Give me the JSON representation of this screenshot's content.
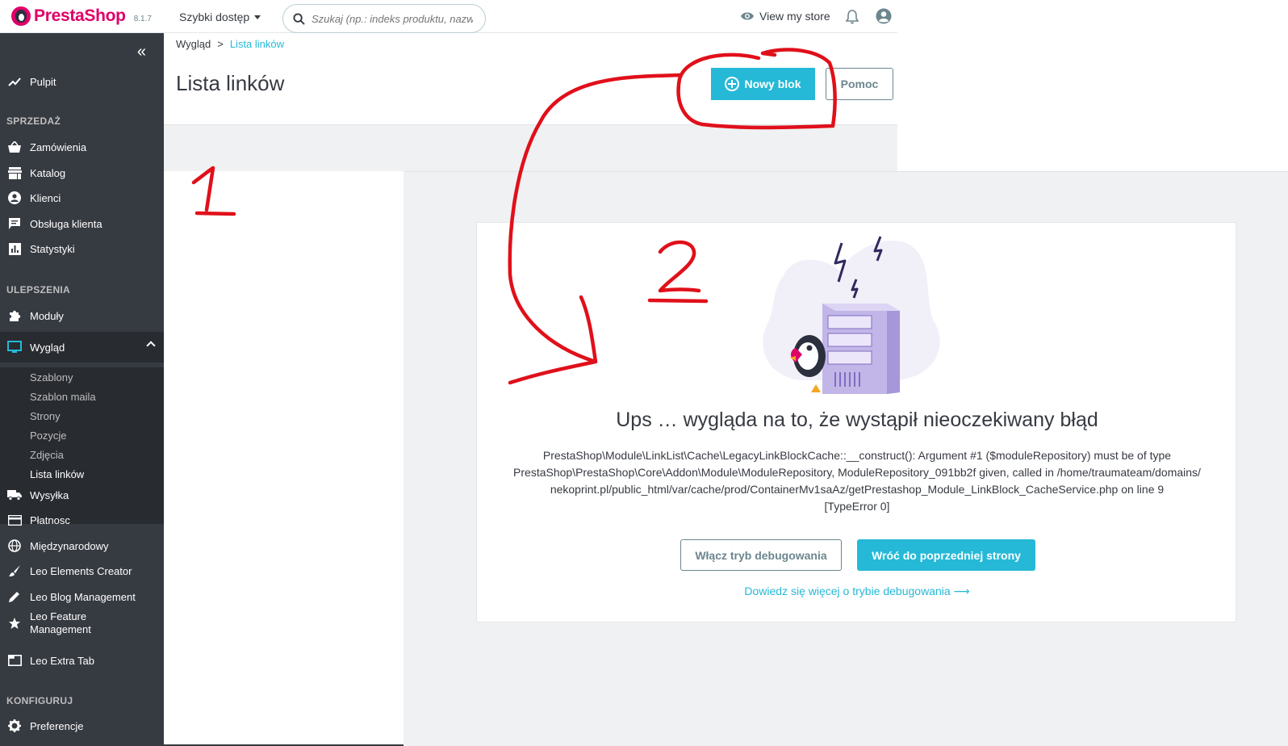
{
  "header": {
    "logo_text": "PrestaShop",
    "version": "8.1.7",
    "quick_access": "Szybki dostęp",
    "search_placeholder": "Szukaj (np.: indeks produktu, nazwa k",
    "view_store": "View my store"
  },
  "sidebar": {
    "dashboard": "Pulpit",
    "section_sales": "SPRZEDAŻ",
    "orders": "Zamówienia",
    "catalog": "Katalog",
    "customers": "Klienci",
    "customer_service": "Obsługa klienta",
    "stats": "Statystyki",
    "section_improve": "ULEPSZENIA",
    "modules": "Moduły",
    "design": "Wygląd",
    "design_sub": [
      "Szablony",
      "Szablon maila",
      "Strony",
      "Pozycje",
      "Zdjęcia",
      "Lista linków"
    ],
    "shipping": "Wysyłka",
    "payment": "Płatnosc",
    "international": "Międzynarodowy",
    "leo_elements": "Leo Elements Creator",
    "leo_blog": "Leo Blog Management",
    "leo_feature_1": "Leo Feature",
    "leo_feature_2": "Management",
    "leo_extra": "Leo Extra Tab",
    "section_config": "KONFIGURUJ",
    "preferences": "Preferencje"
  },
  "page": {
    "breadcrumb_parent": "Wygląd",
    "breadcrumb_sep": ">",
    "breadcrumb_current": "Lista linków",
    "title": "Lista linków",
    "new_block_button": "Nowy blok",
    "help_button": "Pomoc"
  },
  "error": {
    "title": "Ups … wygląda na to, że wystąpił nieoczekiwany błąd",
    "line1": "PrestaShop\\Module\\LinkList\\Cache\\LegacyLinkBlockCache::__construct(): Argument #1 ($moduleRepository) must be of type",
    "line2": "PrestaShop\\PrestaShop\\Core\\Addon\\Module\\ModuleRepository, ModuleRepository_091bb2f given, called in /home/traumateam/domains/",
    "line3": "nekoprint.pl/public_html/var/cache/prod/ContainerMv1saAz/getPrestashop_Module_LinkBlock_CacheService.php on line 9",
    "line4": "[TypeError 0]",
    "debug_button": "Włącz tryb debugowania",
    "back_button": "Wróć do poprzedniej strony",
    "learn_more": "Dowiedz się więcej o trybie debugowania ⟶"
  },
  "annotations": {
    "mark_1": "1",
    "mark_2": "2",
    "color": "#e0101a"
  },
  "colors": {
    "accent": "#25b9d7",
    "sidebar_bg": "#363a41",
    "brand": "#df0067"
  }
}
